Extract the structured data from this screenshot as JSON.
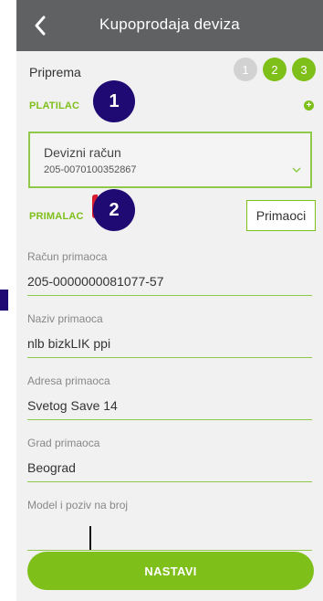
{
  "header": {
    "title": "Kupoprodaja deviza",
    "back_icon": "chevron-left-icon"
  },
  "prep": {
    "title": "Priprema",
    "steps": [
      "1",
      "2",
      "3"
    ],
    "colors": {
      "active": "#7fbf1a",
      "inactive": "#d2d2d2"
    }
  },
  "payer": {
    "label": "PLATILAC",
    "add_icon": "plus-circle-icon",
    "account_title": "Devizni račun",
    "account_number": "205-0070100352867",
    "dropdown_icon": "chevron-down-icon"
  },
  "recipient": {
    "label": "PRIMALAC",
    "recipients_button": "Primaoci",
    "fields": [
      {
        "label": "Račun primaoca",
        "value": "205-0000000081077-57"
      },
      {
        "label": "Naziv primaoca",
        "value": "nlb bizkLIK ppi"
      },
      {
        "label": "Adresa primaoca",
        "value": "Svetog Save 14"
      },
      {
        "label": "Grad primaoca",
        "value": "Beograd"
      },
      {
        "label": "Model i poziv na broj",
        "value": ""
      }
    ]
  },
  "actions": {
    "continue": "NASTAVI"
  },
  "annotations": {
    "marker1": "1",
    "marker2": "2",
    "color": "#1f0a73"
  }
}
